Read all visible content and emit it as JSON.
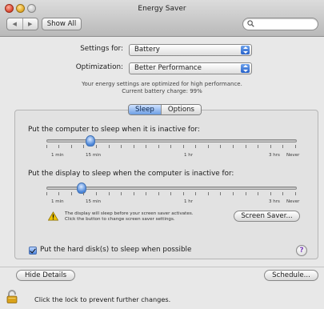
{
  "window": {
    "title": "Energy Saver"
  },
  "toolbar": {
    "back_glyph": "◀",
    "forward_glyph": "▶",
    "show_all_label": "Show All",
    "search_value": "",
    "search_placeholder": ""
  },
  "settings": {
    "settings_for_label": "Settings for:",
    "settings_for_value": "Battery",
    "optimization_label": "Optimization:",
    "optimization_value": "Better Performance",
    "info_line1": "Your energy settings are optimized for high performance.",
    "info_line2": "Current battery charge: 99%"
  },
  "tabs": [
    {
      "label": "Sleep",
      "active": true
    },
    {
      "label": "Options",
      "active": false
    }
  ],
  "sleep_panel": {
    "computer_sleep_label": "Put the computer to sleep when it is inactive for:",
    "display_sleep_label": "Put the display to sleep when the computer is inactive for:",
    "scale_labels": [
      "1 min",
      "15 min",
      "1 hr",
      "3 hrs",
      "Never"
    ],
    "computer_sleep_value": "15 min",
    "display_sleep_value": "10 min",
    "warning_line1": "The display will sleep before your screen saver activates.",
    "warning_line2": "Click the button to change screen saver settings.",
    "screen_saver_button": "Screen Saver...",
    "hard_disk_label": "Put the hard disk(s) to sleep when possible",
    "hard_disk_checked": true,
    "help_label": "?"
  },
  "footer": {
    "hide_details_button": "Hide Details",
    "schedule_button": "Schedule...",
    "lock_text": "Click the lock to prevent further changes."
  },
  "colors": {
    "accent": "#4a85d8",
    "warning": "#f0c400",
    "window_bg": "#e8e8e8"
  },
  "icons": [
    "close-button",
    "minimize-button",
    "zoom-button",
    "search-icon",
    "warning-icon",
    "lock-icon",
    "help-icon"
  ]
}
